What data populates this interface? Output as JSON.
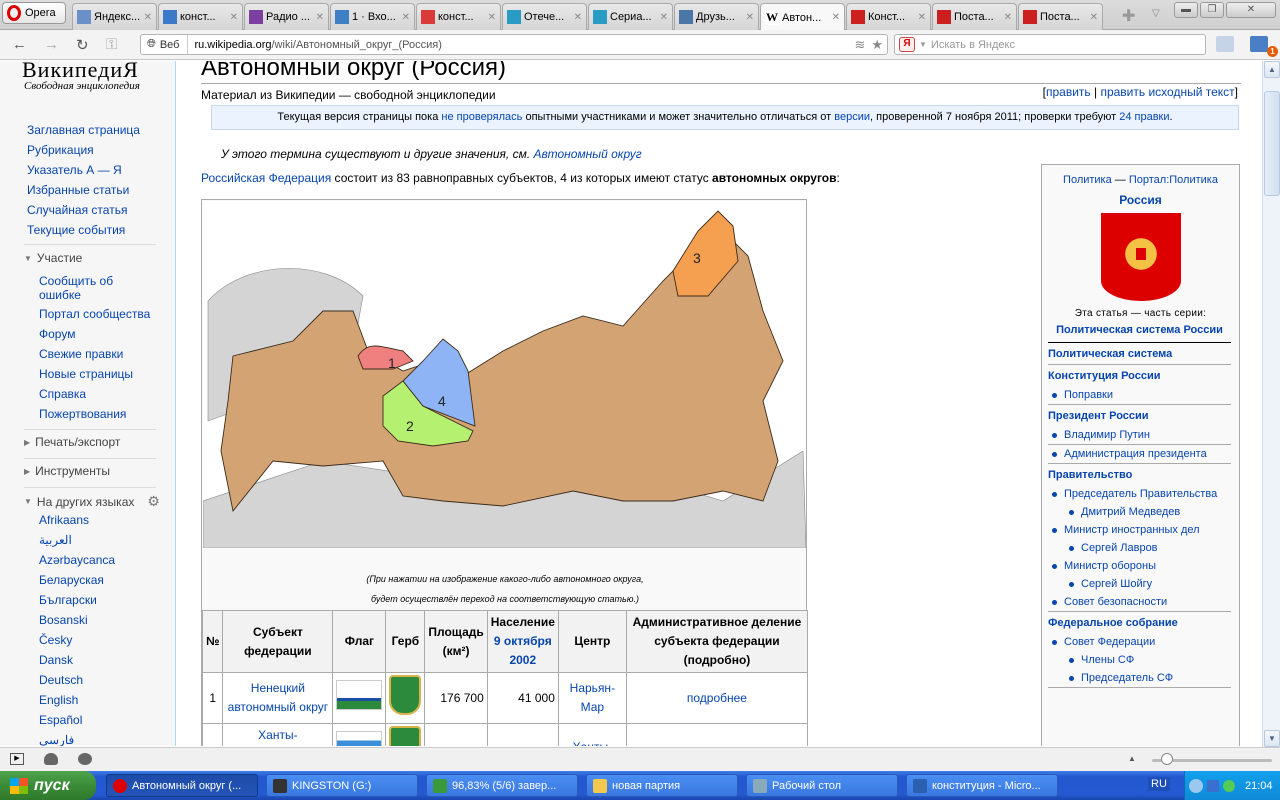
{
  "browser": {
    "menu_label": "Opera",
    "tabs": [
      {
        "label": "Яндекс...",
        "icon": "yandex-icon",
        "color": "#6b8fc7"
      },
      {
        "label": "конст...",
        "icon": "audio-icon",
        "color": "#3d79c9"
      },
      {
        "label": "Радио ...",
        "icon": "radio-icon",
        "color": "#7b3fa0"
      },
      {
        "label": "1 · Вхо...",
        "icon": "mail-icon",
        "color": "#3f7fc6"
      },
      {
        "label": "конст...",
        "icon": "yandex-icon",
        "color": "#d93b3b"
      },
      {
        "label": "Отече...",
        "icon": "tfile-icon",
        "color": "#2a9bc4"
      },
      {
        "label": "Сериа...",
        "icon": "tfile-icon",
        "color": "#2a9bc4"
      },
      {
        "label": "Друзь...",
        "icon": "vk-icon",
        "color": "#4a76a8"
      },
      {
        "label": "Автон...",
        "icon": "wikipedia-icon",
        "color": "#ffffff",
        "active": true
      },
      {
        "label": "Конст...",
        "icon": "russia-coat-icon",
        "color": "#cc1f1f"
      },
      {
        "label": "Поста...",
        "icon": "russia-coat-icon",
        "color": "#cc1f1f"
      },
      {
        "label": "Поста...",
        "icon": "russia-coat-icon",
        "color": "#cc1f1f"
      }
    ],
    "address": {
      "scope_label": "Веб",
      "host": "ru.wikipedia.org",
      "path": "/wiki/Автономный_округ_(Россия)"
    },
    "search_placeholder": "Искать в Яндекс",
    "mail_badge": "1"
  },
  "sidebar": {
    "logo_title": "ВикипедиЯ",
    "logo_subtitle": "Свободная энциклопедия",
    "nav": [
      "Заглавная страница",
      "Рубрикация",
      "Указатель А — Я",
      "Избранные статьи",
      "Случайная статья",
      "Текущие события"
    ],
    "participation_header": "Участие",
    "participation": [
      "Сообщить об ошибке",
      "Портал сообщества",
      "Форум",
      "Свежие правки",
      "Новые страницы",
      "Справка",
      "Пожертвования"
    ],
    "print_header": "Печать/экспорт",
    "tools_header": "Инструменты",
    "languages_header": "На других языках",
    "languages": [
      "Afrikaans",
      "العربية",
      "Azərbaycanca",
      "Беларуская",
      "Български",
      "Bosanski",
      "Česky",
      "Dansk",
      "Deutsch",
      "English",
      "Español",
      "فارسی"
    ]
  },
  "article": {
    "title": "Автономный округ (Россия)",
    "tagline": "Материал из Википедии — свободной энциклопедии",
    "edit": "править",
    "edit_source": "править исходный текст",
    "notice": {
      "pre": "Текущая версия страницы пока ",
      "link1": "не проверялась",
      "mid": " опытными участниками и может значительно отличаться от ",
      "link2": "версии",
      "post": ", проверенной 7 ноября 2011; проверки требуют ",
      "link3": "24 правки",
      "end": "."
    },
    "hatnote_text": "У этого термина существуют и другие значения, см. ",
    "hatnote_link": "Автономный округ",
    "intro_link": "Российская Федерация",
    "intro_text": " состоит из 83 равноправных субъектов, 4 из которых имеют статус ",
    "intro_bold": "автономных округов",
    "intro_end": ":",
    "map_labels": [
      "1",
      "2",
      "3",
      "4"
    ],
    "caption_line1": "(При нажатии на изображение какого-либо автономного округа,",
    "caption_line2": "будет осуществлён переход на соответствующую статью.)",
    "table": {
      "headers": {
        "num": "№",
        "subject": "Субъект федерации",
        "flag": "Флаг",
        "coat": "Герб",
        "area": "Площадь (км²)",
        "population": "Население",
        "population_date": "9 октября 2002",
        "center": "Центр",
        "admin": "Административное деление субъекта федерации (подробно)"
      },
      "rows": [
        {
          "num": "1",
          "subject": "Ненецкий автономный округ",
          "area": "176 700",
          "population": "41 000",
          "center": "Нарьян-Мар",
          "admin": "подробнее"
        },
        {
          "num": "",
          "subject": "Ханты-",
          "area": "",
          "population": "",
          "center": "Ханты-",
          "admin": ""
        }
      ]
    }
  },
  "infobox": {
    "portal_left": "Политика",
    "portal_right": "Портал:Политика",
    "country": "Россия",
    "series_label": "Эта статья — часть серии:",
    "series_title": "Политическая система России",
    "sections": [
      {
        "header": "Политическая система",
        "items": []
      },
      {
        "header": "Конституция России",
        "items": [
          {
            "label": "Поправки",
            "level": 1
          }
        ]
      },
      {
        "header": "Президент России",
        "items": [
          {
            "label": "Владимир Путин",
            "level": 1,
            "sep": true
          },
          {
            "label": "Администрация президента",
            "level": 1
          }
        ]
      },
      {
        "header": "Правительство",
        "items": [
          {
            "label": "Председатель Правительства",
            "level": 1
          },
          {
            "label": "Дмитрий Медведев",
            "level": 2
          },
          {
            "label": "Министр иностранных дел",
            "level": 1
          },
          {
            "label": "Сергей Лавров",
            "level": 2
          },
          {
            "label": "Министр обороны",
            "level": 1
          },
          {
            "label": "Сергей Шойгу",
            "level": 2
          },
          {
            "label": "Совет безопасности",
            "level": 1
          }
        ]
      },
      {
        "header": "Федеральное собрание",
        "items": [
          {
            "label": "Совет Федерации",
            "level": 1
          },
          {
            "label": "Члены СФ",
            "level": 2
          },
          {
            "label": "Председатель СФ",
            "level": 2
          }
        ]
      }
    ]
  },
  "taskbar": {
    "start_label": "пуск",
    "tasks": [
      {
        "label": "Автономный округ (...",
        "icon": "opera-icon",
        "color": "#d00",
        "active": true
      },
      {
        "label": "KINGSTON (G:)",
        "icon": "drive-icon",
        "color": "#333"
      },
      {
        "label": "96,83% (5/6) завер...",
        "icon": "download-icon",
        "color": "#3a9a3a"
      },
      {
        "label": "новая партия",
        "icon": "folder-icon",
        "color": "#f2c94c"
      },
      {
        "label": "Рабочий стол",
        "icon": "desktop-icon",
        "color": "#8ab"
      },
      {
        "label": "конституция - Micro...",
        "icon": "word-icon",
        "color": "#2b5fb0"
      }
    ],
    "language": "RU",
    "clock": "21:04"
  }
}
